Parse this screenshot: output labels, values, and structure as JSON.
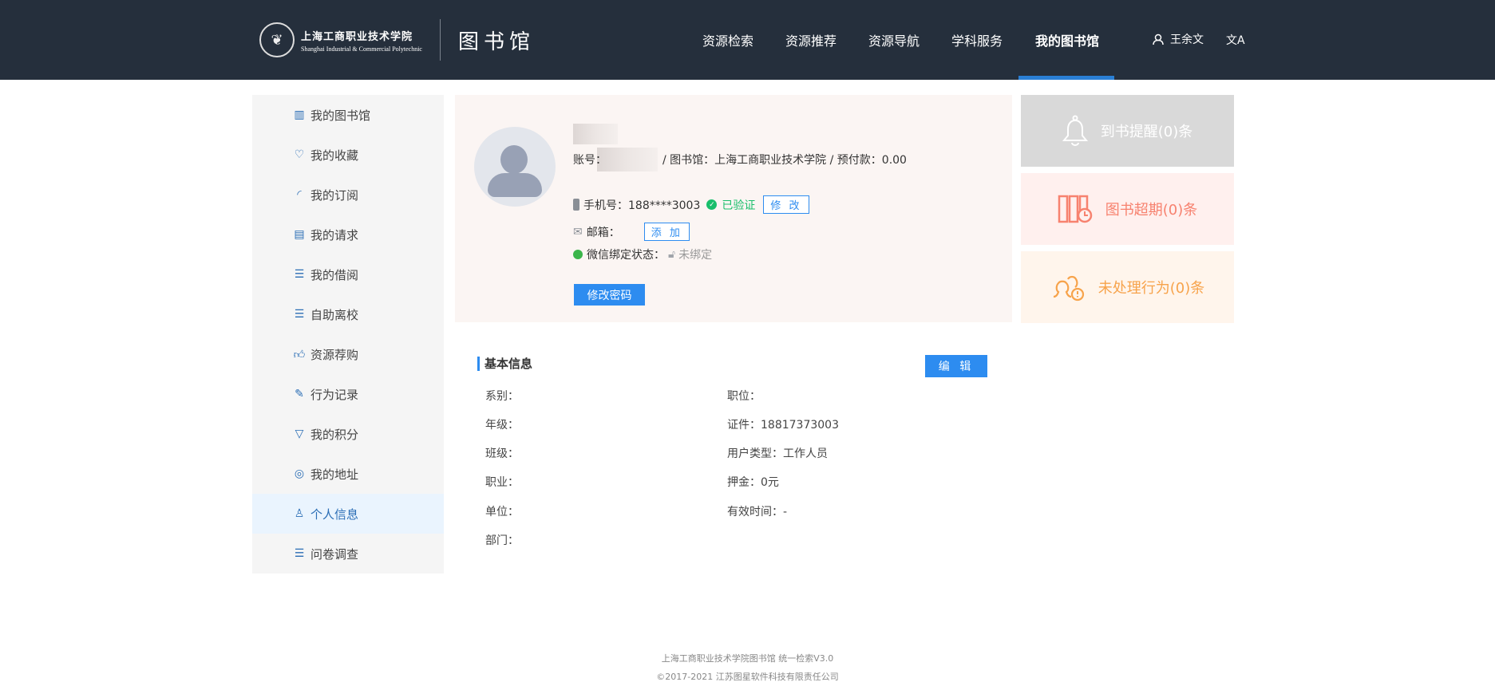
{
  "header": {
    "school_cn": "上海工商职业技术学院",
    "school_en": "Shanghai Industrial & Commercial Polytechnic",
    "library": "图书馆",
    "nav": [
      "资源检索",
      "资源推荐",
      "资源导航",
      "学科服务",
      "我的图书馆"
    ],
    "active_nav": "我的图书馆",
    "user": "王余文",
    "lang_icon": "文A"
  },
  "sidebar": {
    "items": [
      {
        "label": "我的图书馆",
        "icon": "library-icon"
      },
      {
        "label": "我的收藏",
        "icon": "heart-icon"
      },
      {
        "label": "我的订阅",
        "icon": "rss-icon"
      },
      {
        "label": "我的请求",
        "icon": "request-icon"
      },
      {
        "label": "我的借阅",
        "icon": "borrow-icon"
      },
      {
        "label": "自助离校",
        "icon": "leave-icon"
      },
      {
        "label": "资源荐购",
        "icon": "thumbs-up-icon"
      },
      {
        "label": "行为记录",
        "icon": "record-icon"
      },
      {
        "label": "我的积分",
        "icon": "points-icon"
      },
      {
        "label": "我的地址",
        "icon": "location-icon"
      },
      {
        "label": "个人信息",
        "icon": "user-icon"
      },
      {
        "label": "问卷调查",
        "icon": "survey-icon"
      }
    ],
    "active": "个人信息"
  },
  "profile": {
    "account_label": "账号：",
    "account_rest": "/ 图书馆：上海工商职业技术学院 / 预付款：0.00",
    "phone_label": "手机号：188****3003",
    "verified": "已验证",
    "modify": "修 改",
    "email_label": "邮箱：",
    "add": "添 加",
    "wechat_label": "微信绑定状态：",
    "wechat_status": "未绑定",
    "change_password": "修改密码"
  },
  "cards": [
    {
      "label": "到书提醒(0)条",
      "color": "#ffffff",
      "bg": "#d9d9d9"
    },
    {
      "label": "图书超期(0)条",
      "color": "#f7826f",
      "bg": "#fff0ee"
    },
    {
      "label": "未处理行为(0)条",
      "color": "#f7a34b",
      "bg": "#fff5ec"
    }
  ],
  "basic": {
    "title": "基本信息",
    "edit": "编 辑",
    "left": [
      "系别：",
      "年级：",
      "班级：",
      "职业：",
      "单位：",
      "部门："
    ],
    "right": [
      "职位：",
      "证件：18817373003",
      "用户类型：工作人员",
      "押金：0元",
      "有效时间：-"
    ]
  },
  "footer": {
    "line1": "上海工商职业技术学院图书馆  统一检索V3.0",
    "line2": "©2017-2021  江苏图星软件科技有限责任公司"
  }
}
